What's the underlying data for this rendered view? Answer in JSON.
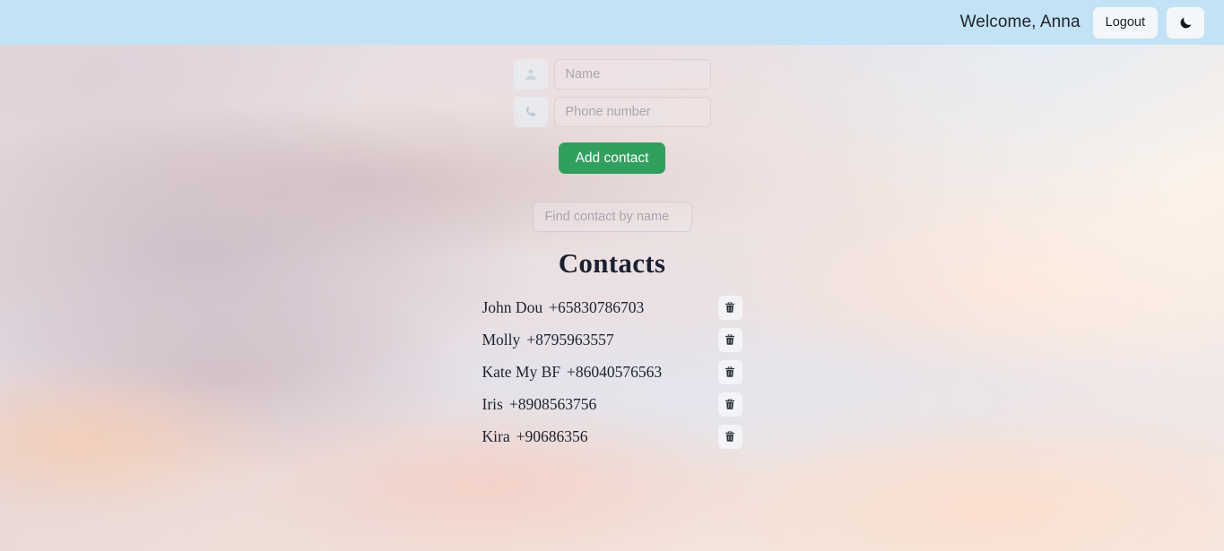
{
  "header": {
    "welcome": "Welcome, Anna",
    "logout_label": "Logout",
    "theme_toggle_icon": "moon-icon",
    "background_color": "#c2e2f5"
  },
  "form": {
    "name_field": {
      "placeholder": "Name",
      "value": "",
      "icon": "user-icon"
    },
    "phone_field": {
      "placeholder": "Phone number",
      "value": "",
      "icon": "phone-icon"
    },
    "submit_label": "Add contact",
    "submit_color": "#31a05f"
  },
  "filter": {
    "placeholder": "Find contact by name",
    "value": ""
  },
  "contacts": {
    "title": "Contacts",
    "delete_icon": "trash-icon",
    "items": [
      {
        "name": "John Dou",
        "number": "+65830786703"
      },
      {
        "name": "Molly",
        "number": "+8795963557"
      },
      {
        "name": "Kate My BF",
        "number": "+86040576563"
      },
      {
        "name": "Iris",
        "number": "+8908563756"
      },
      {
        "name": "Kira",
        "number": "+90686356"
      }
    ]
  }
}
